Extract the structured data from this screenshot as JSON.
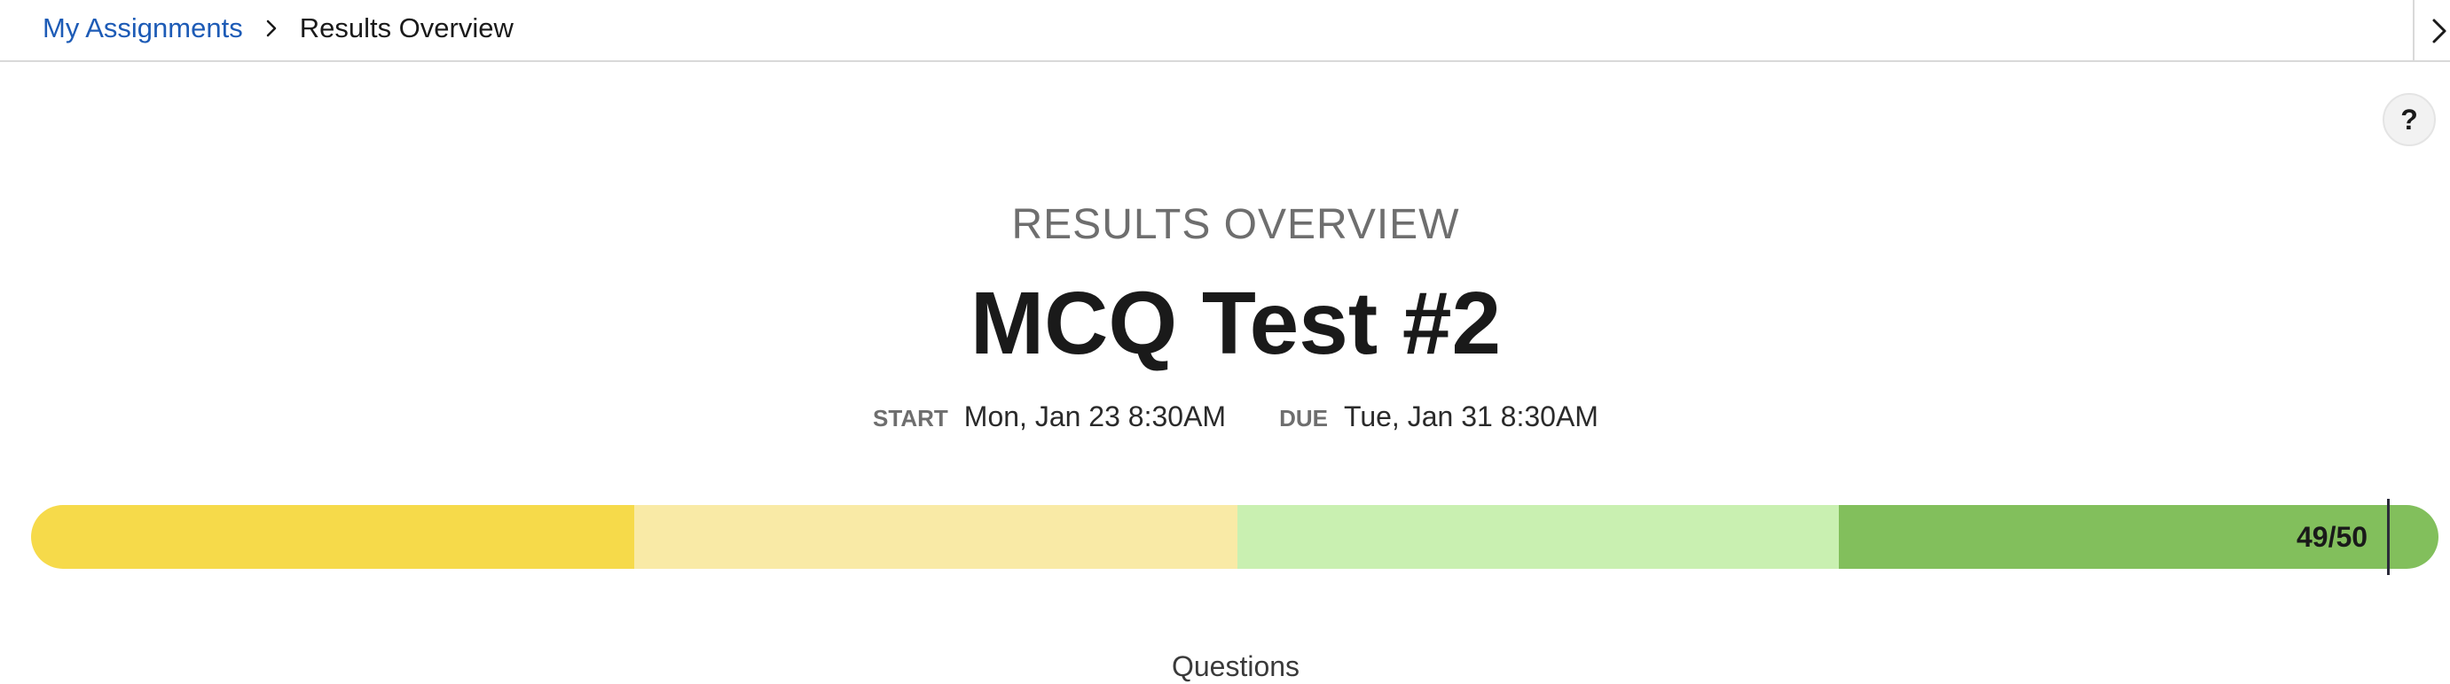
{
  "breadcrumb": {
    "parent_label": "My Assignments",
    "current_label": "Results Overview"
  },
  "header": {
    "section_label": "RESULTS OVERVIEW",
    "title": "MCQ Test #2"
  },
  "dates": {
    "start_key": "START",
    "start_value": "Mon, Jan 23 8:30AM",
    "due_key": "DUE",
    "due_value": "Tue, Jan 31 8:30AM"
  },
  "score": {
    "label": "49/50",
    "earned": 49,
    "total": 50,
    "band_colors": [
      "#f6da4a",
      "#f9eaa6",
      "#c9f0b1",
      "#82bf5c"
    ]
  },
  "help": {
    "label": "?"
  },
  "section": {
    "questions_label": "Questions"
  },
  "icons": {
    "breadcrumb_separator": "chevron-right-icon",
    "close": "chevron-right-icon"
  }
}
